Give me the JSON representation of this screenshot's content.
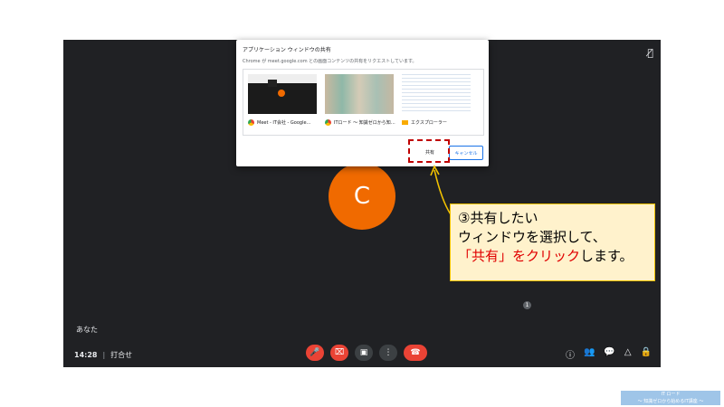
{
  "dialog": {
    "title": "アプリケーション ウィンドウの共有",
    "subtitle": "Chrome が meet.google.com との画面コンテンツの共有をリクエストしています。",
    "windows": [
      {
        "label": "Meet - IT会社 - Google…",
        "icon": "chrome-icon"
      },
      {
        "label": "ITロード ～ 知識ゼロから知…",
        "icon": "chrome-icon"
      },
      {
        "label": "エクスプローラー",
        "icon": "folder-icon"
      }
    ],
    "share_label": "共有",
    "cancel_label": "キャンセル"
  },
  "meeting": {
    "avatar_letter": "C",
    "you_label": "あなた",
    "time": "14:28",
    "separator": "|",
    "meeting_name": "打合せ",
    "participant_count": "1"
  },
  "callout": {
    "line1": "③共有したい",
    "line2": "ウィンドウを選択して、",
    "line3_red": "「共有」をクリック",
    "line3_rest": "します。"
  },
  "watermark": {
    "line1": "IT ロード",
    "line2": "～ 知識ゼロから始めるIT講座 ～"
  },
  "colors": {
    "meet_bg": "#202124",
    "avatar": "#f06a00",
    "end_call": "#ea4335",
    "highlight": "#c00000",
    "callout_bg": "#fff2cc",
    "arrow": "#f2c200"
  }
}
